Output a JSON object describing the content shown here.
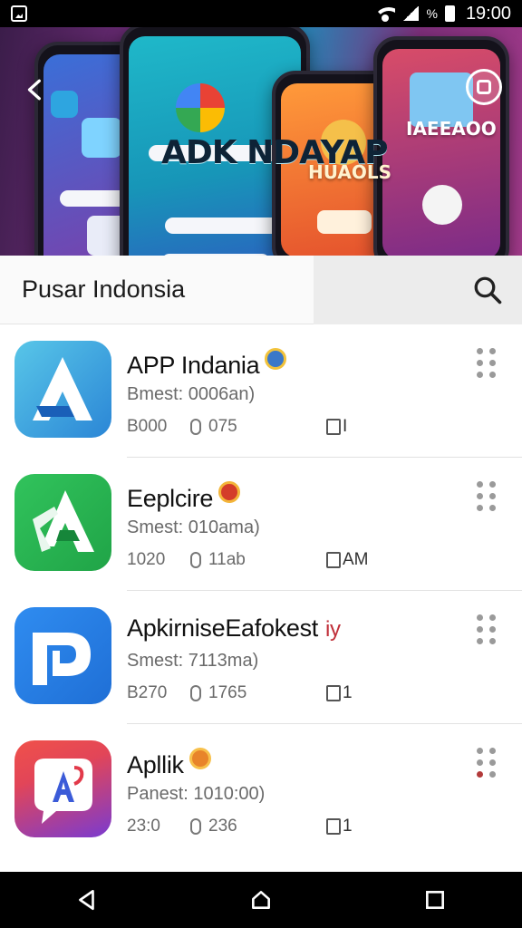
{
  "status_bar": {
    "time": "19:00",
    "battery_label": "%"
  },
  "banner": {
    "text_main": "ADK NDAYAP",
    "text_second": "HUAOLS",
    "text_third": "IAEEAOO"
  },
  "search": {
    "title": "Pusar Indonsia"
  },
  "apps": [
    {
      "title": "APP Indania",
      "subtitle": "Bmest: 0006an)",
      "downloads": "B000",
      "size": "075",
      "extra": "I",
      "badge_color": "#3a78c9",
      "icon": {
        "bg": "#2b86d6",
        "bg2": "#58c6e8",
        "glyph": "A"
      }
    },
    {
      "title": "Eeplcire",
      "subtitle": "Smest: 010ama)",
      "downloads": "1020",
      "size": "11ab",
      "extra": "AM",
      "badge_color": "#d43c2a",
      "icon": {
        "bg": "#20a447",
        "bg2": "#31c35c",
        "glyph": "A"
      }
    },
    {
      "title": "ApkirniseEafokest",
      "title_suffix": "iy",
      "subtitle": "Smest: 7113ma)",
      "downloads": "B270",
      "size": "1765",
      "extra": "1",
      "badge_color": "#d43c2a",
      "icon": {
        "bg": "#1f6fd6",
        "bg2": "#2f8cf0",
        "glyph": "P"
      }
    },
    {
      "title": "Apllik",
      "subtitle": "Panest: 1010:00)",
      "downloads": "23:0",
      "size": "236",
      "extra": "1",
      "badge_color": "#e8842a",
      "icon": {
        "bg": "#e24558",
        "bg2": "#7a3bd0",
        "glyph": "A"
      }
    }
  ]
}
